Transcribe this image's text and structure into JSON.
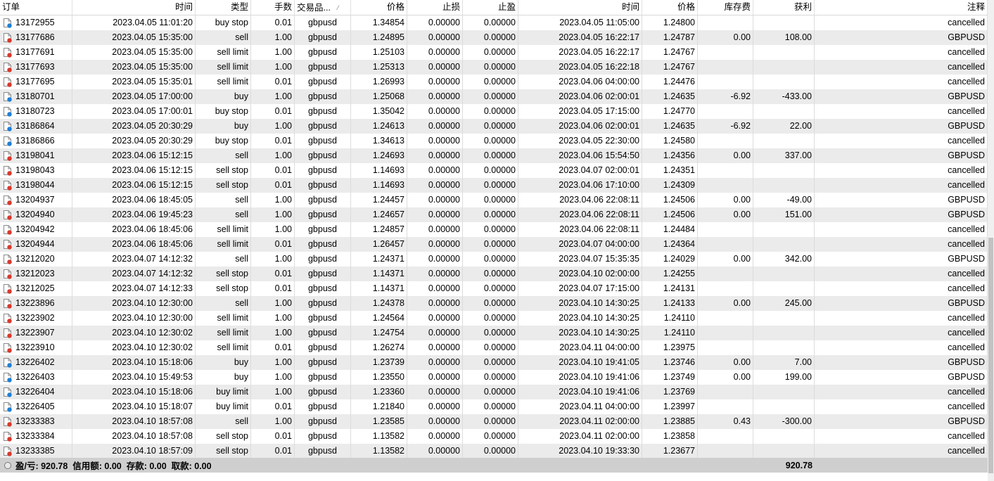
{
  "columns": {
    "ticket": "订单",
    "open_time": "时间",
    "type": "类型",
    "lots": "手数",
    "symbol": "交易品...",
    "open_price": "价格",
    "sl": "止损",
    "tp": "止盈",
    "close_time": "时间",
    "close_price": "价格",
    "swap": "库存费",
    "profit": "获利",
    "comment": "注释"
  },
  "sort_icon": "sort-indicator-icon",
  "colors": {
    "buy_icon": "#1e7fd8",
    "sell_icon": "#d9382b",
    "alt_row": "#ebebeb",
    "summary_bg": "#cfcfcf"
  },
  "rows": [
    {
      "ticket": "13172955",
      "side": "buy",
      "open_time": "2023.04.05 11:01:20",
      "type": "buy stop",
      "lots": "0.01",
      "symbol": "gbpusd",
      "open_price": "1.34854",
      "sl": "0.00000",
      "tp": "0.00000",
      "close_time": "2023.04.05 11:05:00",
      "close_price": "1.24800",
      "swap": "",
      "profit": "",
      "comment": "cancelled"
    },
    {
      "ticket": "13177686",
      "side": "sell",
      "open_time": "2023.04.05 15:35:00",
      "type": "sell",
      "lots": "1.00",
      "symbol": "gbpusd",
      "open_price": "1.24895",
      "sl": "0.00000",
      "tp": "0.00000",
      "close_time": "2023.04.05 16:22:17",
      "close_price": "1.24787",
      "swap": "0.00",
      "profit": "108.00",
      "comment": "GBPUSD"
    },
    {
      "ticket": "13177691",
      "side": "sell",
      "open_time": "2023.04.05 15:35:00",
      "type": "sell limit",
      "lots": "1.00",
      "symbol": "gbpusd",
      "open_price": "1.25103",
      "sl": "0.00000",
      "tp": "0.00000",
      "close_time": "2023.04.05 16:22:17",
      "close_price": "1.24767",
      "swap": "",
      "profit": "",
      "comment": "cancelled"
    },
    {
      "ticket": "13177693",
      "side": "sell",
      "open_time": "2023.04.05 15:35:00",
      "type": "sell limit",
      "lots": "1.00",
      "symbol": "gbpusd",
      "open_price": "1.25313",
      "sl": "0.00000",
      "tp": "0.00000",
      "close_time": "2023.04.05 16:22:18",
      "close_price": "1.24767",
      "swap": "",
      "profit": "",
      "comment": "cancelled"
    },
    {
      "ticket": "13177695",
      "side": "sell",
      "open_time": "2023.04.05 15:35:01",
      "type": "sell limit",
      "lots": "0.01",
      "symbol": "gbpusd",
      "open_price": "1.26993",
      "sl": "0.00000",
      "tp": "0.00000",
      "close_time": "2023.04.06 04:00:00",
      "close_price": "1.24476",
      "swap": "",
      "profit": "",
      "comment": "cancelled"
    },
    {
      "ticket": "13180701",
      "side": "buy",
      "open_time": "2023.04.05 17:00:00",
      "type": "buy",
      "lots": "1.00",
      "symbol": "gbpusd",
      "open_price": "1.25068",
      "sl": "0.00000",
      "tp": "0.00000",
      "close_time": "2023.04.06 02:00:01",
      "close_price": "1.24635",
      "swap": "-6.92",
      "profit": "-433.00",
      "comment": "GBPUSD"
    },
    {
      "ticket": "13180723",
      "side": "buy",
      "open_time": "2023.04.05 17:00:01",
      "type": "buy stop",
      "lots": "0.01",
      "symbol": "gbpusd",
      "open_price": "1.35042",
      "sl": "0.00000",
      "tp": "0.00000",
      "close_time": "2023.04.05 17:15:00",
      "close_price": "1.24770",
      "swap": "",
      "profit": "",
      "comment": "cancelled"
    },
    {
      "ticket": "13186864",
      "side": "buy",
      "open_time": "2023.04.05 20:30:29",
      "type": "buy",
      "lots": "1.00",
      "symbol": "gbpusd",
      "open_price": "1.24613",
      "sl": "0.00000",
      "tp": "0.00000",
      "close_time": "2023.04.06 02:00:01",
      "close_price": "1.24635",
      "swap": "-6.92",
      "profit": "22.00",
      "comment": "GBPUSD"
    },
    {
      "ticket": "13186866",
      "side": "buy",
      "open_time": "2023.04.05 20:30:29",
      "type": "buy stop",
      "lots": "0.01",
      "symbol": "gbpusd",
      "open_price": "1.34613",
      "sl": "0.00000",
      "tp": "0.00000",
      "close_time": "2023.04.05 22:30:00",
      "close_price": "1.24580",
      "swap": "",
      "profit": "",
      "comment": "cancelled"
    },
    {
      "ticket": "13198041",
      "side": "sell",
      "open_time": "2023.04.06 15:12:15",
      "type": "sell",
      "lots": "1.00",
      "symbol": "gbpusd",
      "open_price": "1.24693",
      "sl": "0.00000",
      "tp": "0.00000",
      "close_time": "2023.04.06 15:54:50",
      "close_price": "1.24356",
      "swap": "0.00",
      "profit": "337.00",
      "comment": "GBPUSD"
    },
    {
      "ticket": "13198043",
      "side": "sell",
      "open_time": "2023.04.06 15:12:15",
      "type": "sell stop",
      "lots": "0.01",
      "symbol": "gbpusd",
      "open_price": "1.14693",
      "sl": "0.00000",
      "tp": "0.00000",
      "close_time": "2023.04.07 02:00:01",
      "close_price": "1.24351",
      "swap": "",
      "profit": "",
      "comment": "cancelled"
    },
    {
      "ticket": "13198044",
      "side": "sell",
      "open_time": "2023.04.06 15:12:15",
      "type": "sell stop",
      "lots": "0.01",
      "symbol": "gbpusd",
      "open_price": "1.14693",
      "sl": "0.00000",
      "tp": "0.00000",
      "close_time": "2023.04.06 17:10:00",
      "close_price": "1.24309",
      "swap": "",
      "profit": "",
      "comment": "cancelled"
    },
    {
      "ticket": "13204937",
      "side": "sell",
      "open_time": "2023.04.06 18:45:05",
      "type": "sell",
      "lots": "1.00",
      "symbol": "gbpusd",
      "open_price": "1.24457",
      "sl": "0.00000",
      "tp": "0.00000",
      "close_time": "2023.04.06 22:08:11",
      "close_price": "1.24506",
      "swap": "0.00",
      "profit": "-49.00",
      "comment": "GBPUSD"
    },
    {
      "ticket": "13204940",
      "side": "sell",
      "open_time": "2023.04.06 19:45:23",
      "type": "sell",
      "lots": "1.00",
      "symbol": "gbpusd",
      "open_price": "1.24657",
      "sl": "0.00000",
      "tp": "0.00000",
      "close_time": "2023.04.06 22:08:11",
      "close_price": "1.24506",
      "swap": "0.00",
      "profit": "151.00",
      "comment": "GBPUSD"
    },
    {
      "ticket": "13204942",
      "side": "sell",
      "open_time": "2023.04.06 18:45:06",
      "type": "sell limit",
      "lots": "1.00",
      "symbol": "gbpusd",
      "open_price": "1.24857",
      "sl": "0.00000",
      "tp": "0.00000",
      "close_time": "2023.04.06 22:08:11",
      "close_price": "1.24484",
      "swap": "",
      "profit": "",
      "comment": "cancelled"
    },
    {
      "ticket": "13204944",
      "side": "sell",
      "open_time": "2023.04.06 18:45:06",
      "type": "sell limit",
      "lots": "0.01",
      "symbol": "gbpusd",
      "open_price": "1.26457",
      "sl": "0.00000",
      "tp": "0.00000",
      "close_time": "2023.04.07 04:00:00",
      "close_price": "1.24364",
      "swap": "",
      "profit": "",
      "comment": "cancelled"
    },
    {
      "ticket": "13212020",
      "side": "sell",
      "open_time": "2023.04.07 14:12:32",
      "type": "sell",
      "lots": "1.00",
      "symbol": "gbpusd",
      "open_price": "1.24371",
      "sl": "0.00000",
      "tp": "0.00000",
      "close_time": "2023.04.07 15:35:35",
      "close_price": "1.24029",
      "swap": "0.00",
      "profit": "342.00",
      "comment": "GBPUSD"
    },
    {
      "ticket": "13212023",
      "side": "sell",
      "open_time": "2023.04.07 14:12:32",
      "type": "sell stop",
      "lots": "0.01",
      "symbol": "gbpusd",
      "open_price": "1.14371",
      "sl": "0.00000",
      "tp": "0.00000",
      "close_time": "2023.04.10 02:00:00",
      "close_price": "1.24255",
      "swap": "",
      "profit": "",
      "comment": "cancelled"
    },
    {
      "ticket": "13212025",
      "side": "sell",
      "open_time": "2023.04.07 14:12:33",
      "type": "sell stop",
      "lots": "0.01",
      "symbol": "gbpusd",
      "open_price": "1.14371",
      "sl": "0.00000",
      "tp": "0.00000",
      "close_time": "2023.04.07 17:15:00",
      "close_price": "1.24131",
      "swap": "",
      "profit": "",
      "comment": "cancelled"
    },
    {
      "ticket": "13223896",
      "side": "sell",
      "open_time": "2023.04.10 12:30:00",
      "type": "sell",
      "lots": "1.00",
      "symbol": "gbpusd",
      "open_price": "1.24378",
      "sl": "0.00000",
      "tp": "0.00000",
      "close_time": "2023.04.10 14:30:25",
      "close_price": "1.24133",
      "swap": "0.00",
      "profit": "245.00",
      "comment": "GBPUSD"
    },
    {
      "ticket": "13223902",
      "side": "sell",
      "open_time": "2023.04.10 12:30:00",
      "type": "sell limit",
      "lots": "1.00",
      "symbol": "gbpusd",
      "open_price": "1.24564",
      "sl": "0.00000",
      "tp": "0.00000",
      "close_time": "2023.04.10 14:30:25",
      "close_price": "1.24110",
      "swap": "",
      "profit": "",
      "comment": "cancelled"
    },
    {
      "ticket": "13223907",
      "side": "sell",
      "open_time": "2023.04.10 12:30:02",
      "type": "sell limit",
      "lots": "1.00",
      "symbol": "gbpusd",
      "open_price": "1.24754",
      "sl": "0.00000",
      "tp": "0.00000",
      "close_time": "2023.04.10 14:30:25",
      "close_price": "1.24110",
      "swap": "",
      "profit": "",
      "comment": "cancelled"
    },
    {
      "ticket": "13223910",
      "side": "sell",
      "open_time": "2023.04.10 12:30:02",
      "type": "sell limit",
      "lots": "0.01",
      "symbol": "gbpusd",
      "open_price": "1.26274",
      "sl": "0.00000",
      "tp": "0.00000",
      "close_time": "2023.04.11 04:00:00",
      "close_price": "1.23975",
      "swap": "",
      "profit": "",
      "comment": "cancelled"
    },
    {
      "ticket": "13226402",
      "side": "buy",
      "open_time": "2023.04.10 15:18:06",
      "type": "buy",
      "lots": "1.00",
      "symbol": "gbpusd",
      "open_price": "1.23739",
      "sl": "0.00000",
      "tp": "0.00000",
      "close_time": "2023.04.10 19:41:05",
      "close_price": "1.23746",
      "swap": "0.00",
      "profit": "7.00",
      "comment": "GBPUSD"
    },
    {
      "ticket": "13226403",
      "side": "buy",
      "open_time": "2023.04.10 15:49:53",
      "type": "buy",
      "lots": "1.00",
      "symbol": "gbpusd",
      "open_price": "1.23550",
      "sl": "0.00000",
      "tp": "0.00000",
      "close_time": "2023.04.10 19:41:06",
      "close_price": "1.23749",
      "swap": "0.00",
      "profit": "199.00",
      "comment": "GBPUSD"
    },
    {
      "ticket": "13226404",
      "side": "buy",
      "open_time": "2023.04.10 15:18:06",
      "type": "buy limit",
      "lots": "1.00",
      "symbol": "gbpusd",
      "open_price": "1.23360",
      "sl": "0.00000",
      "tp": "0.00000",
      "close_time": "2023.04.10 19:41:06",
      "close_price": "1.23769",
      "swap": "",
      "profit": "",
      "comment": "cancelled"
    },
    {
      "ticket": "13226405",
      "side": "buy",
      "open_time": "2023.04.10 15:18:07",
      "type": "buy limit",
      "lots": "0.01",
      "symbol": "gbpusd",
      "open_price": "1.21840",
      "sl": "0.00000",
      "tp": "0.00000",
      "close_time": "2023.04.11 04:00:00",
      "close_price": "1.23997",
      "swap": "",
      "profit": "",
      "comment": "cancelled"
    },
    {
      "ticket": "13233383",
      "side": "sell",
      "open_time": "2023.04.10 18:57:08",
      "type": "sell",
      "lots": "1.00",
      "symbol": "gbpusd",
      "open_price": "1.23585",
      "sl": "0.00000",
      "tp": "0.00000",
      "close_time": "2023.04.11 02:00:00",
      "close_price": "1.23885",
      "swap": "0.43",
      "profit": "-300.00",
      "comment": "GBPUSD"
    },
    {
      "ticket": "13233384",
      "side": "sell",
      "open_time": "2023.04.10 18:57:08",
      "type": "sell stop",
      "lots": "0.01",
      "symbol": "gbpusd",
      "open_price": "1.13582",
      "sl": "0.00000",
      "tp": "0.00000",
      "close_time": "2023.04.11 02:00:00",
      "close_price": "1.23858",
      "swap": "",
      "profit": "",
      "comment": "cancelled"
    },
    {
      "ticket": "13233385",
      "side": "sell",
      "open_time": "2023.04.10 18:57:09",
      "type": "sell stop",
      "lots": "0.01",
      "symbol": "gbpusd",
      "open_price": "1.13582",
      "sl": "0.00000",
      "tp": "0.00000",
      "close_time": "2023.04.10 19:33:30",
      "close_price": "1.23677",
      "swap": "",
      "profit": "",
      "comment": "cancelled"
    }
  ],
  "summary": {
    "text": "盈/亏: 920.78  信用额: 0.00  存款: 0.00  取款: 0.00",
    "profit_total": "920.78"
  }
}
